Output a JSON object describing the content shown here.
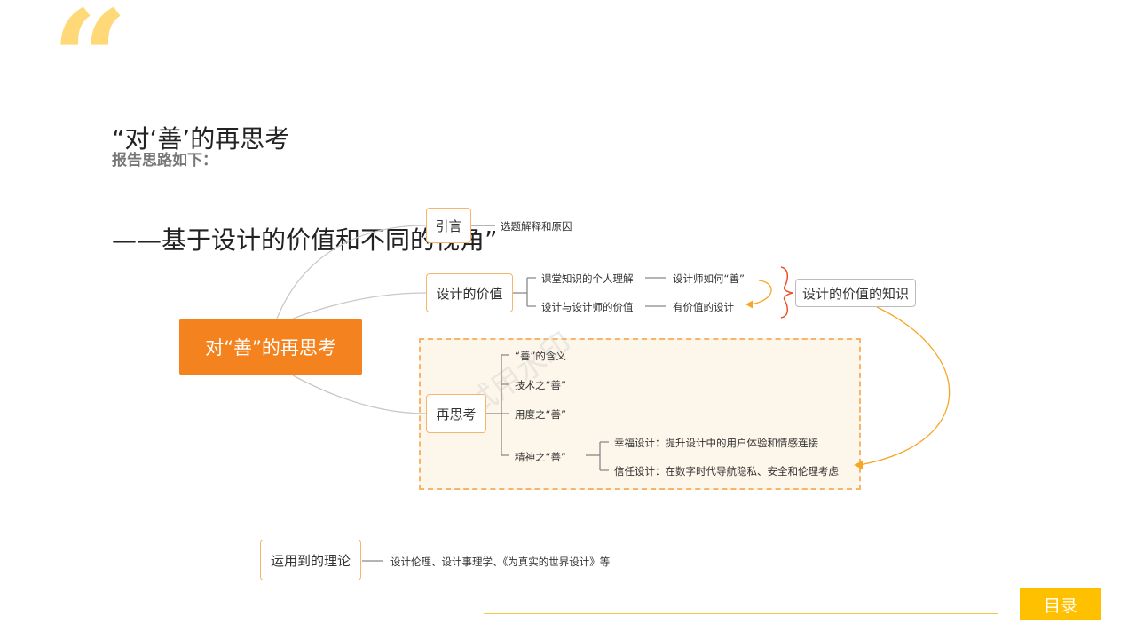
{
  "header": {
    "title_line1": "“对‘善’的再思考",
    "title_line2": "——基于设计的价值和不同的视角”",
    "subtitle": "报告思路如下："
  },
  "mindmap": {
    "root": "对“善”的再思考",
    "branches": {
      "intro": {
        "label": "引言",
        "detail": "选题解释和原因"
      },
      "value": {
        "label": "设计的价值",
        "items": [
          {
            "text": "课堂知识的个人理解",
            "detail": "设计师如何“善”"
          },
          {
            "text": "设计与设计师的价值",
            "detail": "有价值的设计"
          }
        ],
        "summary": "设计的价值的知识"
      },
      "rethink": {
        "label": "再思考",
        "items": [
          "“善”的含义",
          "技术之“善”",
          "用度之“善”",
          "精神之“善”"
        ],
        "spirit_items": [
          "幸福设计：提升设计中的用户体验和情感连接",
          "信任设计：在数字时代导航隐私、安全和伦理考虑"
        ]
      }
    },
    "theory": {
      "label": "运用到的理论",
      "detail": "设计伦理、设计事理学、《为真实的世界设计》等"
    },
    "watermark": "试用水印"
  },
  "footer": {
    "toc_label": "目录"
  },
  "colors": {
    "accent": "#f4831f",
    "quote": "#ffd978",
    "toc": "#ffc000"
  }
}
